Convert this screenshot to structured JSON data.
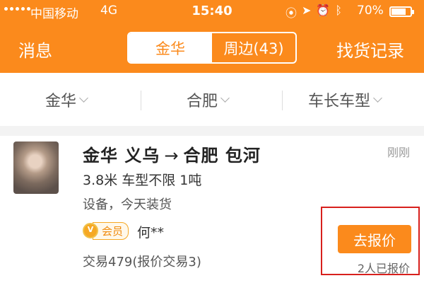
{
  "status_bar": {
    "carrier": "中国移动",
    "network": "4G",
    "time": "15:40",
    "battery_percent": "70%",
    "battery_level": 0.7,
    "icons": [
      "screen-lock-icon",
      "location-icon",
      "alarm-icon",
      "bluetooth-icon"
    ]
  },
  "nav": {
    "left_label": "消息",
    "right_label": "找货记录",
    "tabs": [
      {
        "label": "金华",
        "active": true
      },
      {
        "label": "周边(43)",
        "active": false
      }
    ]
  },
  "filters": [
    {
      "label": "金华"
    },
    {
      "label": "合肥"
    },
    {
      "label": "车长车型"
    }
  ],
  "listing": {
    "from": "金华 义乌",
    "to": "合肥 包河",
    "posted": "刚刚",
    "spec": "3.8米 车型不限 1吨",
    "description": "设备，今天装货",
    "member_badge": "会员",
    "user_name": "何**",
    "trades": "交易479(报价交易3)",
    "quote_button": "去报价",
    "quoted_count": "2人已报价"
  },
  "colors": {
    "brand": "#fb8a1c",
    "highlight": "#d8201d"
  }
}
